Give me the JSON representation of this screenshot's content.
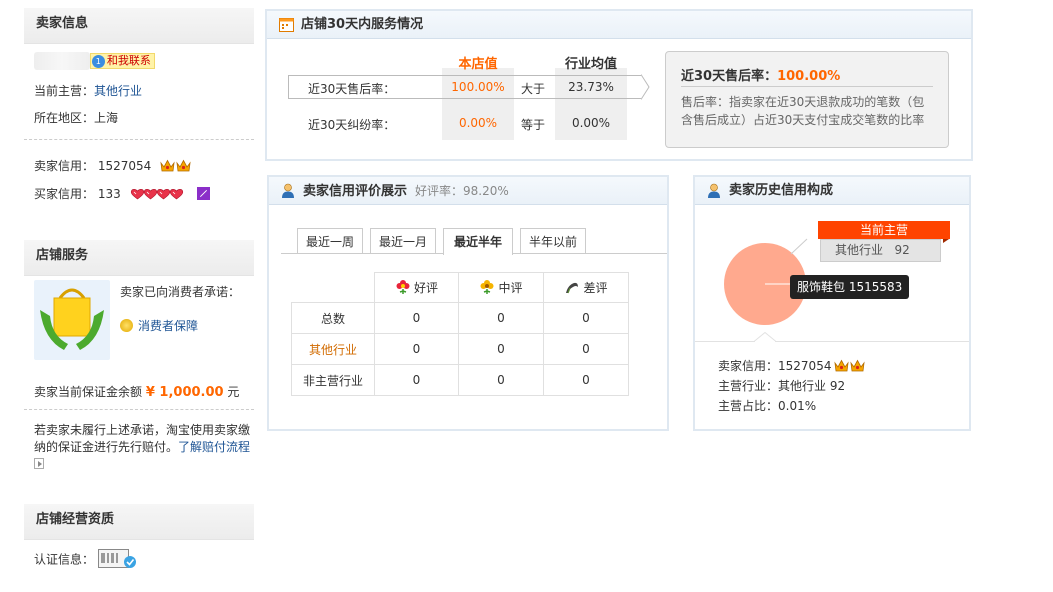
{
  "seller_info": {
    "title": "卖家信息",
    "contact_label": "和我联系",
    "main_business_label": "当前主营：",
    "main_business_value": "其他行业",
    "region_label": "所在地区：",
    "region_value": "上海",
    "seller_credit_label": "卖家信用：",
    "seller_credit_value": "1527054",
    "buyer_credit_label": "买家信用：",
    "buyer_credit_value": "133"
  },
  "shop_service": {
    "title": "店铺服务",
    "promise_text": "卖家已向消费者承诺：",
    "guarantee_link": "消费者保障",
    "deposit_label": "卖家当前保证金余额",
    "deposit_value": "¥ 1,000.00",
    "deposit_unit": "元",
    "compensation_text": "若卖家未履行上述承诺，淘宝使用卖家缴纳的保证金进行先行赔付。",
    "compensation_link": "了解赔付流程"
  },
  "qualification": {
    "title": "店铺经营资质",
    "cert_label": "认证信息："
  },
  "service30": {
    "title": "店铺30天内服务情况",
    "col_shop": "本店值",
    "col_industry": "行业均值",
    "rows": [
      {
        "label": "近30天售后率：",
        "shop": "100.00%",
        "compare": "大于",
        "industry": "23.73%"
      },
      {
        "label": "近30天纠纷率：",
        "shop": "0.00%",
        "compare": "等于",
        "industry": "0.00%"
      }
    ],
    "info_title": "近30天售后率：",
    "info_value": "100.00%",
    "info_desc": "售后率：指卖家在近30天退款成功的笔数（包含售后成立）占近30天支付宝成交笔数的比率"
  },
  "rating": {
    "title": "卖家信用评价展示",
    "good_rate": "好评率：98.20%",
    "tabs": [
      "最近一周",
      "最近一月",
      "最近半年",
      "半年以前"
    ],
    "active_tab": "最近半年",
    "headers": [
      "好评",
      "中评",
      "差评"
    ],
    "rows": [
      {
        "label": "总数",
        "values": [
          "0",
          "0",
          "0"
        ]
      },
      {
        "label": "其他行业",
        "values": [
          "0",
          "0",
          "0"
        ]
      },
      {
        "label": "非主营行业",
        "values": [
          "0",
          "0",
          "0"
        ]
      }
    ]
  },
  "history": {
    "title": "卖家历史信用构成",
    "current_main_label": "当前主营",
    "industry_label": "其他行业",
    "industry_count": "92",
    "tooltip": "服饰鞋包 1515583",
    "seller_credit_label": "卖家信用：",
    "seller_credit_value": "1527054",
    "main_industry_label": "主营行业：",
    "main_industry_value": "其他行业 92",
    "main_ratio_label": "主营占比：",
    "main_ratio_value": "0.01%"
  },
  "colors": {
    "accent_orange": "#ff6600",
    "link_blue": "#1e5494",
    "pie_salmon": "#ffa98e",
    "label_red": "#ff4400"
  }
}
